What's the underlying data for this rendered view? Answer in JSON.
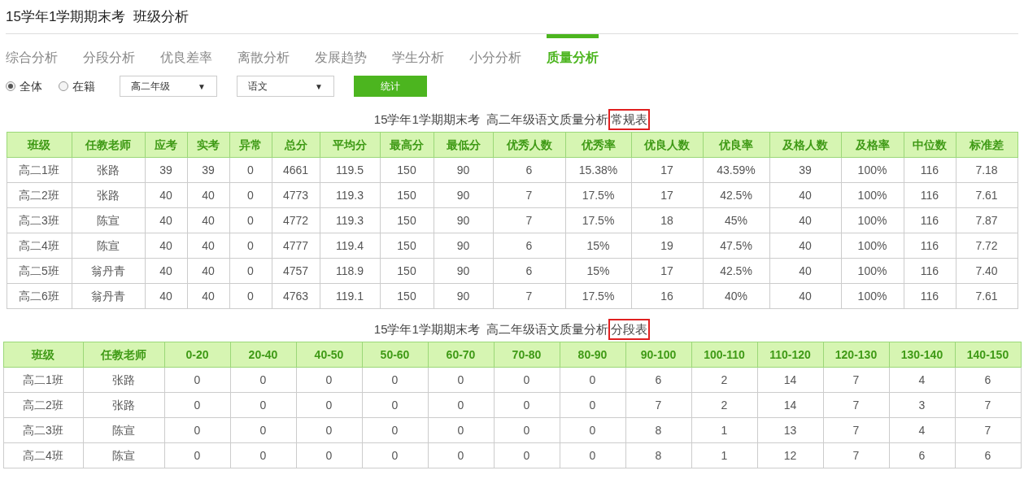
{
  "page_title": "15学年1学期期末考  班级分析",
  "tabs": [
    {
      "label": "综合分析",
      "selected": false
    },
    {
      "label": "分段分析",
      "selected": false
    },
    {
      "label": "优良差率",
      "selected": false
    },
    {
      "label": "离散分析",
      "selected": false
    },
    {
      "label": "发展趋势",
      "selected": false
    },
    {
      "label": "学生分析",
      "selected": false
    },
    {
      "label": "小分分析",
      "selected": false
    },
    {
      "label": "质量分析",
      "selected": true
    }
  ],
  "filters": {
    "radios": [
      {
        "label": "全体",
        "selected": true
      },
      {
        "label": "在籍",
        "selected": false
      }
    ],
    "grade_select": {
      "value": "高二年级",
      "caret": "▼"
    },
    "subject_select": {
      "value": "语文",
      "caret": "▼"
    },
    "submit_button": "统计"
  },
  "tables": [
    {
      "title": "15学年1学期期末考  高二年级语文质量分析",
      "title_highlight": "常规表",
      "columns": [
        "班级",
        "任教老师",
        "应考",
        "实考",
        "异常",
        "总分",
        "平均分",
        "最高分",
        "最低分",
        "优秀人数",
        "优秀率",
        "优良人数",
        "优良率",
        "及格人数",
        "及格率",
        "中位数",
        "标准差"
      ],
      "rows": [
        [
          "高二1班",
          "张路",
          "39",
          "39",
          "0",
          "4661",
          "119.5",
          "150",
          "90",
          "6",
          "15.38%",
          "17",
          "43.59%",
          "39",
          "100%",
          "116",
          "7.18"
        ],
        [
          "高二2班",
          "张路",
          "40",
          "40",
          "0",
          "4773",
          "119.3",
          "150",
          "90",
          "7",
          "17.5%",
          "17",
          "42.5%",
          "40",
          "100%",
          "116",
          "7.61"
        ],
        [
          "高二3班",
          "陈宣",
          "40",
          "40",
          "0",
          "4772",
          "119.3",
          "150",
          "90",
          "7",
          "17.5%",
          "18",
          "45%",
          "40",
          "100%",
          "116",
          "7.87"
        ],
        [
          "高二4班",
          "陈宣",
          "40",
          "40",
          "0",
          "4777",
          "119.4",
          "150",
          "90",
          "6",
          "15%",
          "19",
          "47.5%",
          "40",
          "100%",
          "116",
          "7.72"
        ],
        [
          "高二5班",
          "翁丹青",
          "40",
          "40",
          "0",
          "4757",
          "118.9",
          "150",
          "90",
          "6",
          "15%",
          "17",
          "42.5%",
          "40",
          "100%",
          "116",
          "7.40"
        ],
        [
          "高二6班",
          "翁丹青",
          "40",
          "40",
          "0",
          "4763",
          "119.1",
          "150",
          "90",
          "7",
          "17.5%",
          "16",
          "40%",
          "40",
          "100%",
          "116",
          "7.61"
        ]
      ]
    },
    {
      "title": "15学年1学期期末考  高二年级语文质量分析",
      "title_highlight": "分段表",
      "columns": [
        "班级",
        "任教老师",
        "0-20",
        "20-40",
        "40-50",
        "50-60",
        "60-70",
        "70-80",
        "80-90",
        "90-100",
        "100-110",
        "110-120",
        "120-130",
        "130-140",
        "140-150"
      ],
      "rows": [
        [
          "高二1班",
          "张路",
          "0",
          "0",
          "0",
          "0",
          "0",
          "0",
          "0",
          "6",
          "2",
          "14",
          "7",
          "4",
          "6"
        ],
        [
          "高二2班",
          "张路",
          "0",
          "0",
          "0",
          "0",
          "0",
          "0",
          "0",
          "7",
          "2",
          "14",
          "7",
          "3",
          "7"
        ],
        [
          "高二3班",
          "陈宣",
          "0",
          "0",
          "0",
          "0",
          "0",
          "0",
          "0",
          "8",
          "1",
          "13",
          "7",
          "4",
          "7"
        ],
        [
          "高二4班",
          "陈宣",
          "0",
          "0",
          "0",
          "0",
          "0",
          "0",
          "0",
          "8",
          "1",
          "12",
          "7",
          "6",
          "6"
        ]
      ]
    }
  ]
}
